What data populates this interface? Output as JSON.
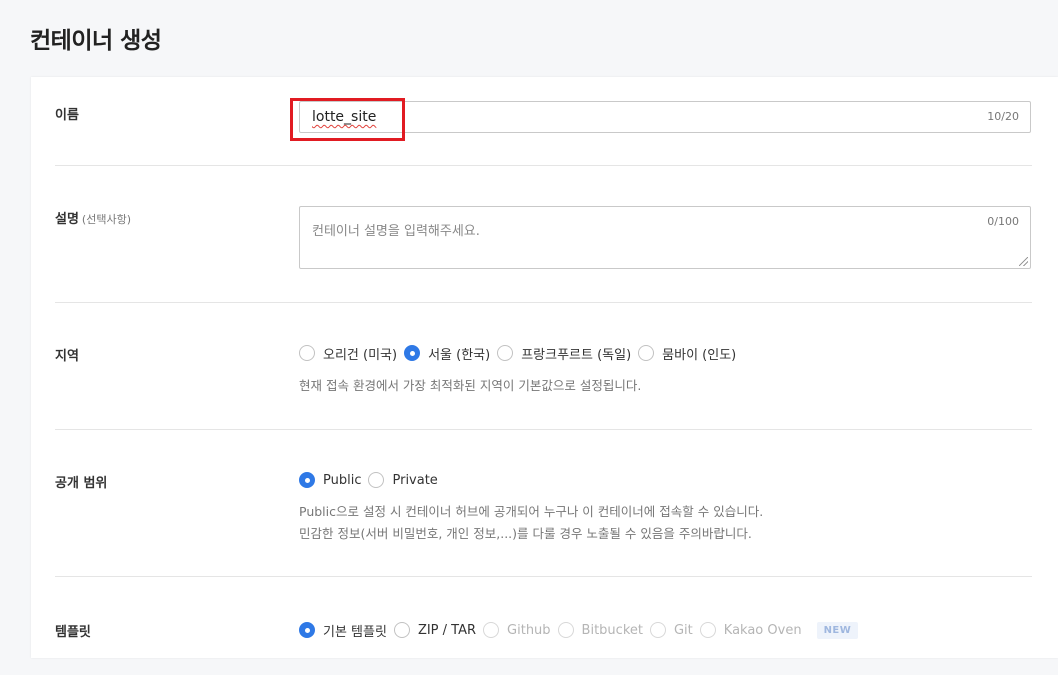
{
  "page": {
    "title": "컨테이너 생성"
  },
  "name": {
    "label": "이름",
    "value": "lotte_site",
    "counter": "10/20"
  },
  "description": {
    "label": "설명",
    "sub_label": "(선택사항)",
    "placeholder": "컨테이너 설명을 입력해주세요.",
    "counter": "0/100"
  },
  "region": {
    "label": "지역",
    "options": [
      {
        "label": "오리건 (미국)",
        "checked": false
      },
      {
        "label": "서울 (한국)",
        "checked": true
      },
      {
        "label": "프랑크푸르트 (독일)",
        "checked": false
      },
      {
        "label": "뭄바이 (인도)",
        "checked": false
      }
    ],
    "help": "현재 접속 환경에서 가장 최적화된 지역이 기본값으로 설정됩니다."
  },
  "visibility": {
    "label": "공개 범위",
    "options": [
      {
        "label": "Public",
        "checked": true
      },
      {
        "label": "Private",
        "checked": false
      }
    ],
    "help_line1": "Public으로 설정 시 컨테이너 허브에 공개되어 누구나 이 컨테이너에 접속할 수 있습니다.",
    "help_line2": "민감한 정보(서버 비밀번호, 개인 정보,...)를 다룰 경우 노출될 수 있음을 주의바랍니다."
  },
  "template": {
    "label": "템플릿",
    "options": [
      {
        "label": "기본 템플릿",
        "checked": true,
        "disabled": false
      },
      {
        "label": "ZIP / TAR",
        "checked": false,
        "disabled": false
      },
      {
        "label": "Github",
        "checked": false,
        "disabled": true
      },
      {
        "label": "Bitbucket",
        "checked": false,
        "disabled": true
      },
      {
        "label": "Git",
        "checked": false,
        "disabled": true
      },
      {
        "label": "Kakao Oven",
        "checked": false,
        "disabled": true
      }
    ],
    "new_badge": "NEW"
  },
  "colors": {
    "accent": "#2f79e6",
    "highlight": "#e11b22"
  }
}
